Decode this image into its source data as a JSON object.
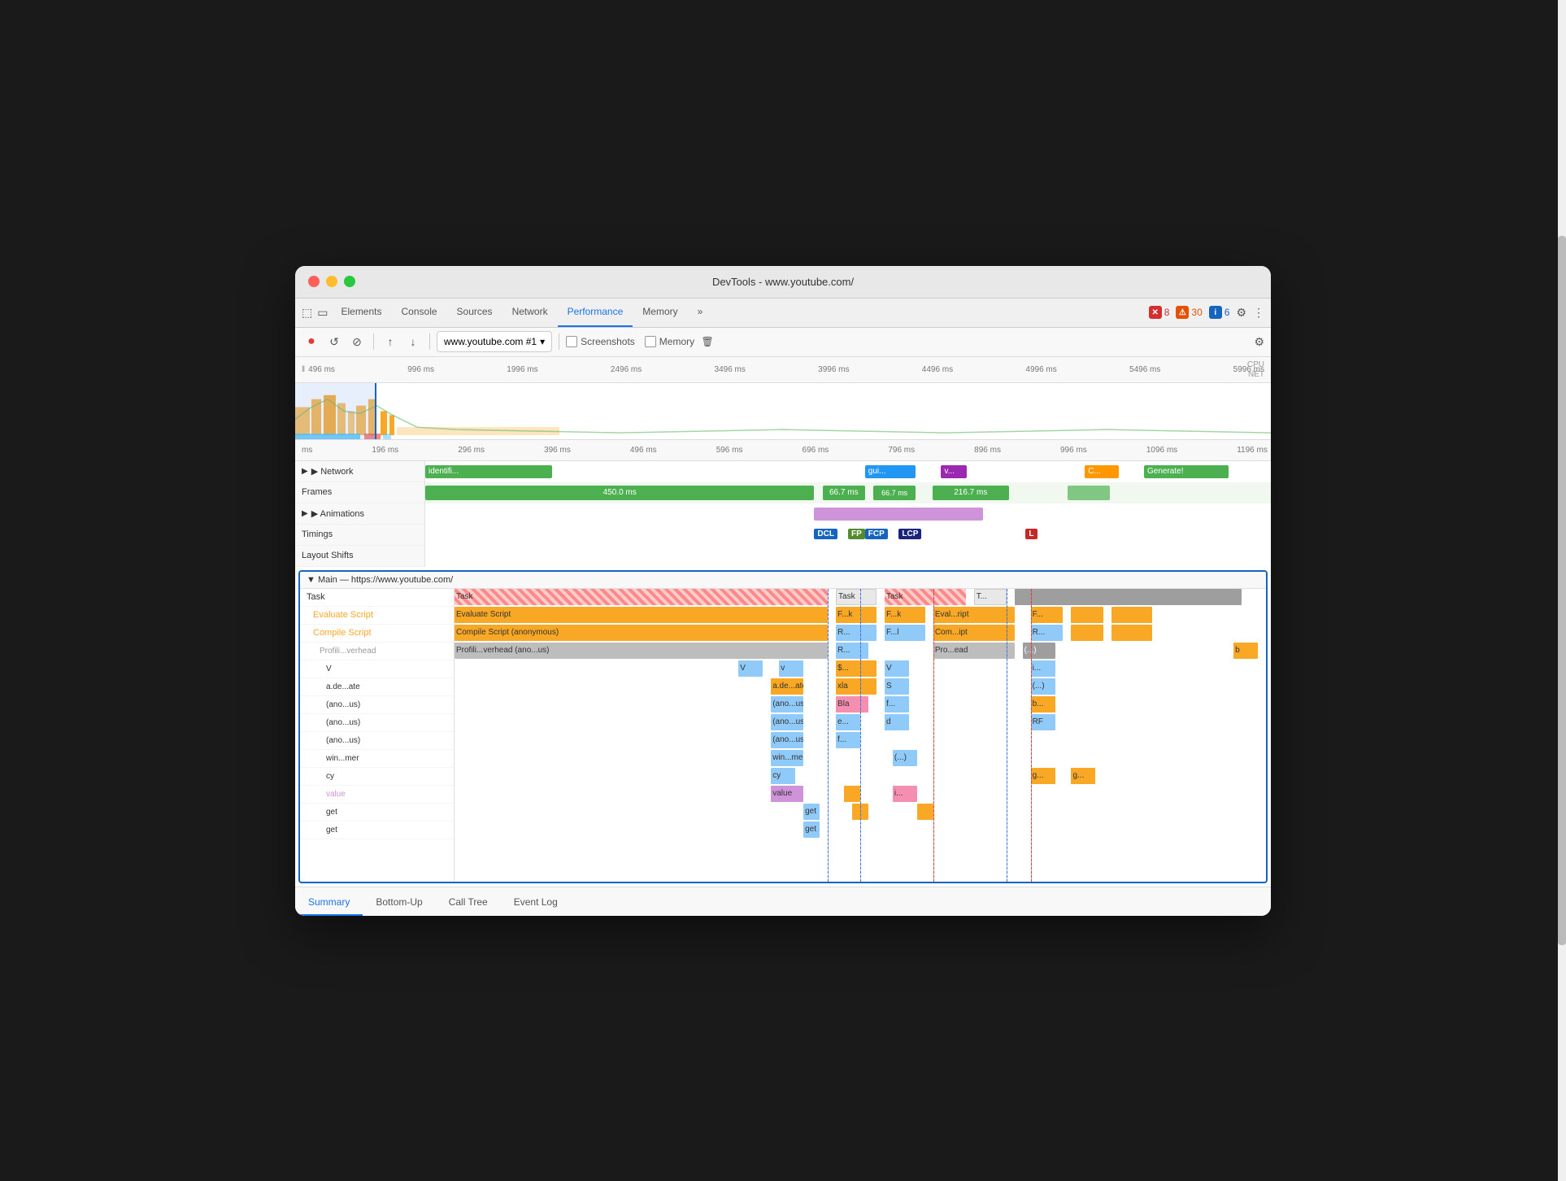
{
  "window": {
    "title": "DevTools - www.youtube.com/"
  },
  "tabs": {
    "items": [
      {
        "label": "Elements",
        "active": false
      },
      {
        "label": "Console",
        "active": false
      },
      {
        "label": "Sources",
        "active": false
      },
      {
        "label": "Network",
        "active": false
      },
      {
        "label": "Performance",
        "active": true
      },
      {
        "label": "Memory",
        "active": false
      }
    ],
    "overflow": "»",
    "badge_errors": "8",
    "badge_warnings": "30",
    "badge_info": "6"
  },
  "toolbar": {
    "record_label": "●",
    "reload_label": "↺",
    "clear_label": "⊘",
    "upload_label": "↑",
    "download_label": "↓",
    "profile_dropdown": "www.youtube.com #1",
    "screenshots_label": "Screenshots",
    "memory_label": "Memory",
    "settings_label": "⚙"
  },
  "ruler": {
    "marks": [
      "496 ms",
      "996 ms",
      "1996 ms",
      "2496 ms",
      "3496 ms",
      "3996 ms",
      "4496 ms",
      "4996 ms",
      "5496 ms",
      "5996 ms"
    ]
  },
  "timeline_labels": {
    "cpu": "CPU",
    "net": "NET"
  },
  "timeline_ms_row": {
    "marks": [
      "196 ms",
      "296 ms",
      "396 ms",
      "496 ms",
      "596 ms",
      "696 ms",
      "796 ms",
      "896 ms",
      "996 ms",
      "1096 ms",
      "1196 ms"
    ]
  },
  "tracks": {
    "network": {
      "label": "▶ Network",
      "expanded": false
    },
    "frames": {
      "label": "Frames",
      "expanded": false
    },
    "animations": {
      "label": "▶ Animations",
      "expanded": false
    },
    "timings": {
      "label": "Timings",
      "expanded": false
    },
    "layout_shifts": {
      "label": "Layout Shifts",
      "expanded": false
    }
  },
  "timings": {
    "dcl": "DCL",
    "fp": "FP",
    "fcp": "FCP",
    "lcp": "LCP",
    "l": "L"
  },
  "main": {
    "header": "▼ Main — https://www.youtube.com/",
    "rows": [
      {
        "label": "Task",
        "color": "task"
      },
      {
        "label": "Evaluate Script",
        "color": "script"
      },
      {
        "label": "Compile Script",
        "color": "compile"
      },
      {
        "label": "Profili...verhead",
        "color": "profiling"
      },
      {
        "label": "",
        "color": ""
      },
      {
        "label": "",
        "color": ""
      },
      {
        "label": "",
        "color": ""
      },
      {
        "label": "",
        "color": ""
      },
      {
        "label": "",
        "color": ""
      },
      {
        "label": "",
        "color": ""
      },
      {
        "label": "",
        "color": ""
      },
      {
        "label": "",
        "color": ""
      },
      {
        "label": "",
        "color": ""
      }
    ]
  },
  "bottom_tabs": {
    "items": [
      {
        "label": "Summary",
        "active": true
      },
      {
        "label": "Bottom-Up",
        "active": false
      },
      {
        "label": "Call Tree",
        "active": false
      },
      {
        "label": "Event Log",
        "active": false
      }
    ]
  }
}
